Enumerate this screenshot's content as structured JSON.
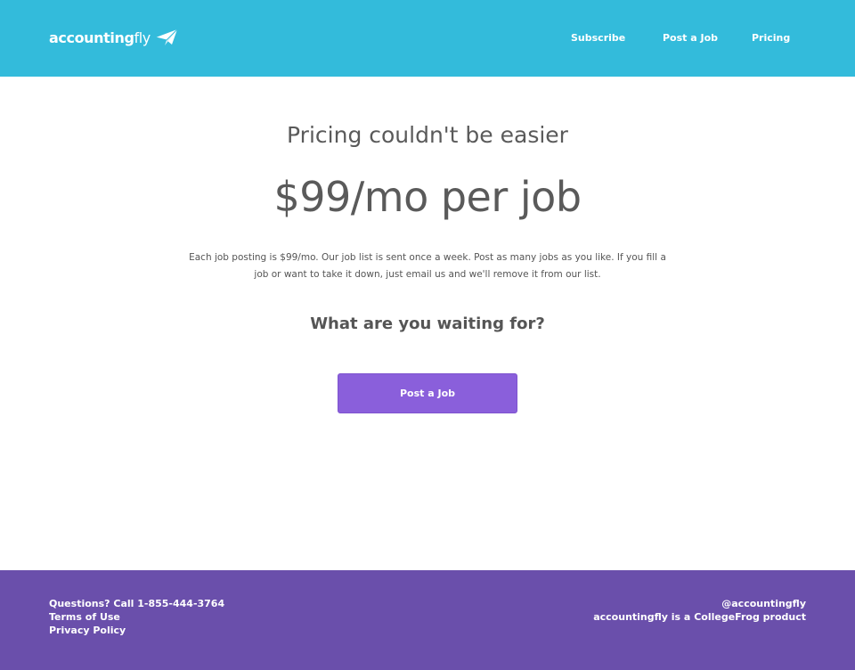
{
  "header": {
    "logo_bold": "accounting",
    "logo_light": "fly",
    "logo_icon": "paper-plane-icon",
    "nav": [
      "Subscribe",
      "Post a Job",
      "Pricing"
    ]
  },
  "main": {
    "headline": "Pricing couldn't be easier",
    "price": "$99/mo per job",
    "description": "Each job posting is $99/mo. Our job list is sent once a week. Post as many jobs as you like. If you fill a job or want to take it down, just email us and we'll remove it from our list.",
    "question": "What are you waiting for?",
    "cta_label": "Post a Job"
  },
  "footer": {
    "phone": "Questions? Call 1-855-444-3764",
    "terms": "Terms of Use",
    "privacy": "Privacy Policy",
    "handle": "@accountingfly",
    "product": "accountingfly is a CollegeFrog product"
  },
  "colors": {
    "header_bg": "#33bbdb",
    "button_bg": "#8a5fdb",
    "footer_bg": "#6a4fab"
  }
}
